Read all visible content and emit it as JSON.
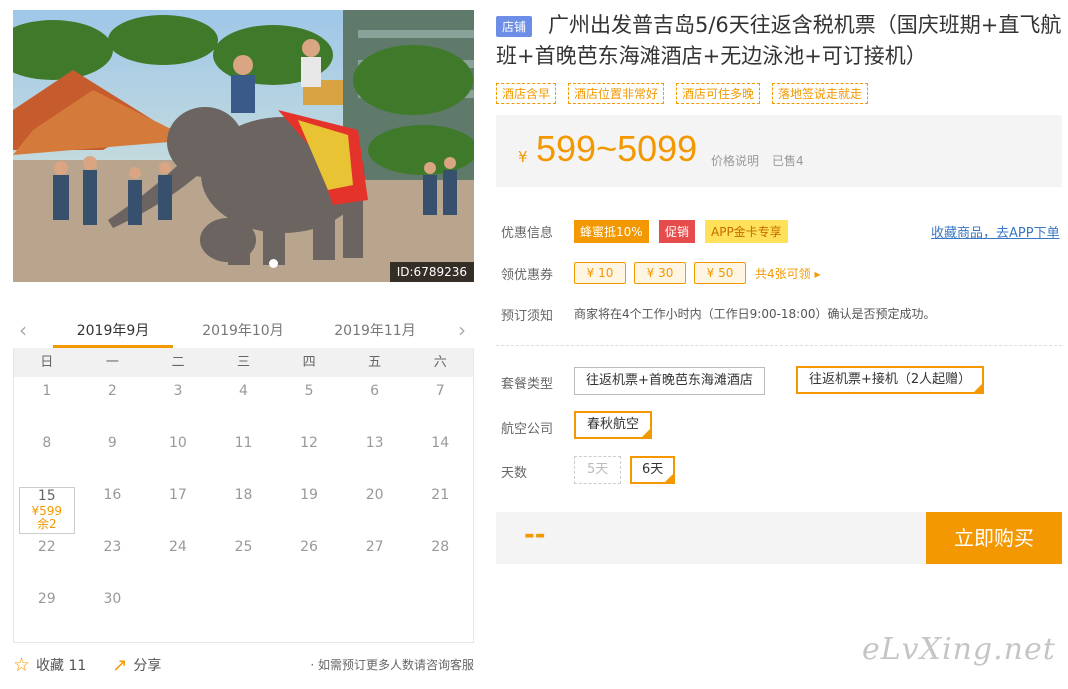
{
  "gallery": {
    "image_id": "ID:6789236"
  },
  "calendar": {
    "months": [
      "2019年9月",
      "2019年10月",
      "2019年11月"
    ],
    "weekdays": [
      "日",
      "一",
      "二",
      "三",
      "四",
      "五",
      "六"
    ],
    "rows": [
      [
        {
          "d": "1"
        },
        {
          "d": "2"
        },
        {
          "d": "3"
        },
        {
          "d": "4"
        },
        {
          "d": "5"
        },
        {
          "d": "6"
        },
        {
          "d": "7"
        }
      ],
      [
        {
          "d": "8"
        },
        {
          "d": "9"
        },
        {
          "d": "10"
        },
        {
          "d": "11"
        },
        {
          "d": "12"
        },
        {
          "d": "13"
        },
        {
          "d": "14"
        }
      ],
      [
        {
          "d": "15",
          "price": "¥599",
          "left": "余2"
        },
        {
          "d": "16"
        },
        {
          "d": "17"
        },
        {
          "d": "18"
        },
        {
          "d": "19"
        },
        {
          "d": "20"
        },
        {
          "d": "21"
        }
      ],
      [
        {
          "d": "22"
        },
        {
          "d": "23"
        },
        {
          "d": "24"
        },
        {
          "d": "25"
        },
        {
          "d": "26"
        },
        {
          "d": "27"
        },
        {
          "d": "28"
        }
      ],
      [
        {
          "d": "29"
        },
        {
          "d": "30"
        }
      ]
    ]
  },
  "footer": {
    "collect_label": "收藏 11",
    "share_label": "分享",
    "note": "· 如需预订更多人数请咨询客服"
  },
  "product": {
    "store_badge": "店铺",
    "title": "广州出发普吉岛5/6天往返含税机票（国庆班期+直飞航班+首晚芭东海滩酒店+无边泳池+可订接机）",
    "tags": [
      "酒店含早",
      "酒店位置非常好",
      "酒店可住多晚",
      "落地签说走就走"
    ]
  },
  "price": {
    "currency": "¥",
    "range": "599~5099",
    "desc": "价格说明",
    "sold": "已售4"
  },
  "promo": {
    "label": "优惠信息",
    "items": [
      "蜂蜜抵10%",
      "促销",
      "APP金卡专享"
    ],
    "collect_link": "收藏商品，去APP下单"
  },
  "coupons": {
    "label": "领优惠券",
    "items": [
      "¥ 10",
      "¥ 30",
      "¥ 50"
    ],
    "more": "共4张可领 ▸"
  },
  "booking": {
    "label": "预订须知",
    "text": "商家将在4个工作小时内（工作日9:00-18:00）确认是否预定成功。"
  },
  "options": {
    "package_label": "套餐类型",
    "packages": [
      "往返机票+首晚芭东海滩酒店",
      "往返机票+接机（2人起赠）"
    ],
    "airline_label": "航空公司",
    "airline": "春秋航空",
    "days_label": "天数",
    "days": [
      "5天",
      "6天"
    ]
  },
  "buy": {
    "total": "--",
    "button": "立即购买"
  },
  "watermark": "eLvXing.net",
  "colors": {
    "accent": "#f39800",
    "link": "#3a78c4",
    "store_badge": "#6c8ee6"
  }
}
